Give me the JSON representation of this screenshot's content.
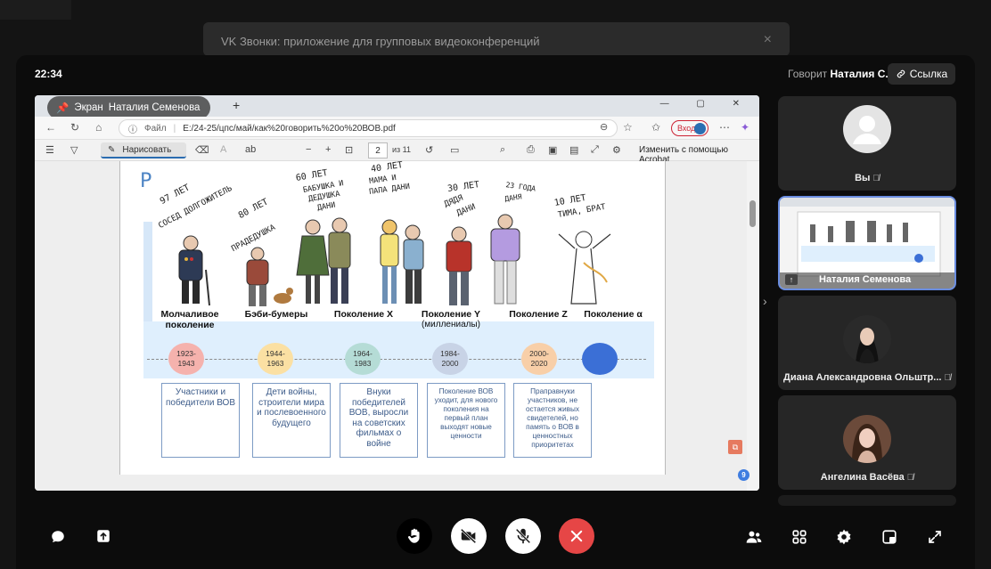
{
  "background": {
    "notification": "VK Звонки: приложение для групповых видеоконференций",
    "close_icon": "×"
  },
  "header": {
    "time": "22:34",
    "speaking_prefix": "Говорит",
    "speaking_name": "Наталия С.",
    "link_label": "Ссылка"
  },
  "shared_screen": {
    "badge": {
      "prefix": "Экран",
      "owner": "Наталия Семенова"
    },
    "browser": {
      "tab_plus": "+",
      "window_controls": "— ▢ ✕",
      "site_label": "Файл",
      "url": "E:/24-25/цпс/май/как%20говорить%20о%20ВОВ.pdf",
      "login_label": "Вход"
    },
    "pdf_toolbar": {
      "draw_label": "Нарисовать",
      "page_current": "2",
      "page_total": "из 11",
      "acrobat_label": "Изменить с помощью Acrobat"
    },
    "slide": {
      "letter": "Р",
      "ages": [
        "97 ЛЕТ",
        "СОСЕД ДОЛГОЖИТЕЛЬ",
        "80 ЛЕТ",
        "ПРАДЕДУШКА",
        "60 ЛЕТ",
        "БАБУШКА И",
        "ДЕДУШКА",
        "ДАНИ",
        "40 ЛЕТ",
        "МАМА И",
        "ПАПА ДАНИ",
        "30 ЛЕТ",
        "ДЯДЯ",
        "ДАНИ",
        "23 ГОДА",
        "ДАНЯ",
        "10 ЛЕТ",
        "ТИМА, БРАТ"
      ],
      "generations": [
        {
          "name": "Молчаливое поколение",
          "sub": ""
        },
        {
          "name": "Бэби-бумеры",
          "sub": ""
        },
        {
          "name": "Поколение X",
          "sub": ""
        },
        {
          "name": "Поколение Y",
          "sub": "(миллениалы)"
        },
        {
          "name": "Поколение Z",
          "sub": ""
        },
        {
          "name": "Поколение α",
          "sub": ""
        }
      ],
      "years": [
        "1923-\n1943",
        "1944-\n1963",
        "1964-\n1983",
        "1984-\n2000",
        "2000-\n2020",
        ""
      ],
      "year_colors": [
        "#f5b2ad",
        "#fbe0a3",
        "#b5dcd6",
        "#c8d3e6",
        "#f8cfa8",
        "#3b6fd6"
      ],
      "descriptions": [
        "Участники и победители ВОВ",
        "Дети войны, строители мира и послевоенного будущего",
        "Внуки победителей ВОВ, выросли на советских фильмах о войне",
        "Поколение ВОВ уходит, для нового поколения на первый план выходят новые ценности",
        "Праправнуки участников, не остается живых свидетелей, но память о ВОВ в ценностных приоритетах"
      ]
    }
  },
  "participants": [
    {
      "name": "Вы",
      "kind": "avatar"
    },
    {
      "name": "Наталия Семенова",
      "kind": "screen"
    },
    {
      "name": "Диана Александровна Ольштр...",
      "kind": "video"
    },
    {
      "name": "Ангелина Васёва",
      "kind": "video"
    }
  ],
  "controls": {
    "participants_count": "9",
    "icons": [
      "chat-icon",
      "share-screen-icon",
      "raise-hand-icon",
      "camera-off-icon",
      "mic-off-icon",
      "end-call-icon",
      "participants-icon",
      "grid-icon",
      "settings-icon",
      "layout-icon",
      "fullscreen-icon"
    ],
    "colors": {
      "end_call": "#e64646",
      "badge": "#3f7de0",
      "accent_border": "#6a8de0"
    }
  }
}
